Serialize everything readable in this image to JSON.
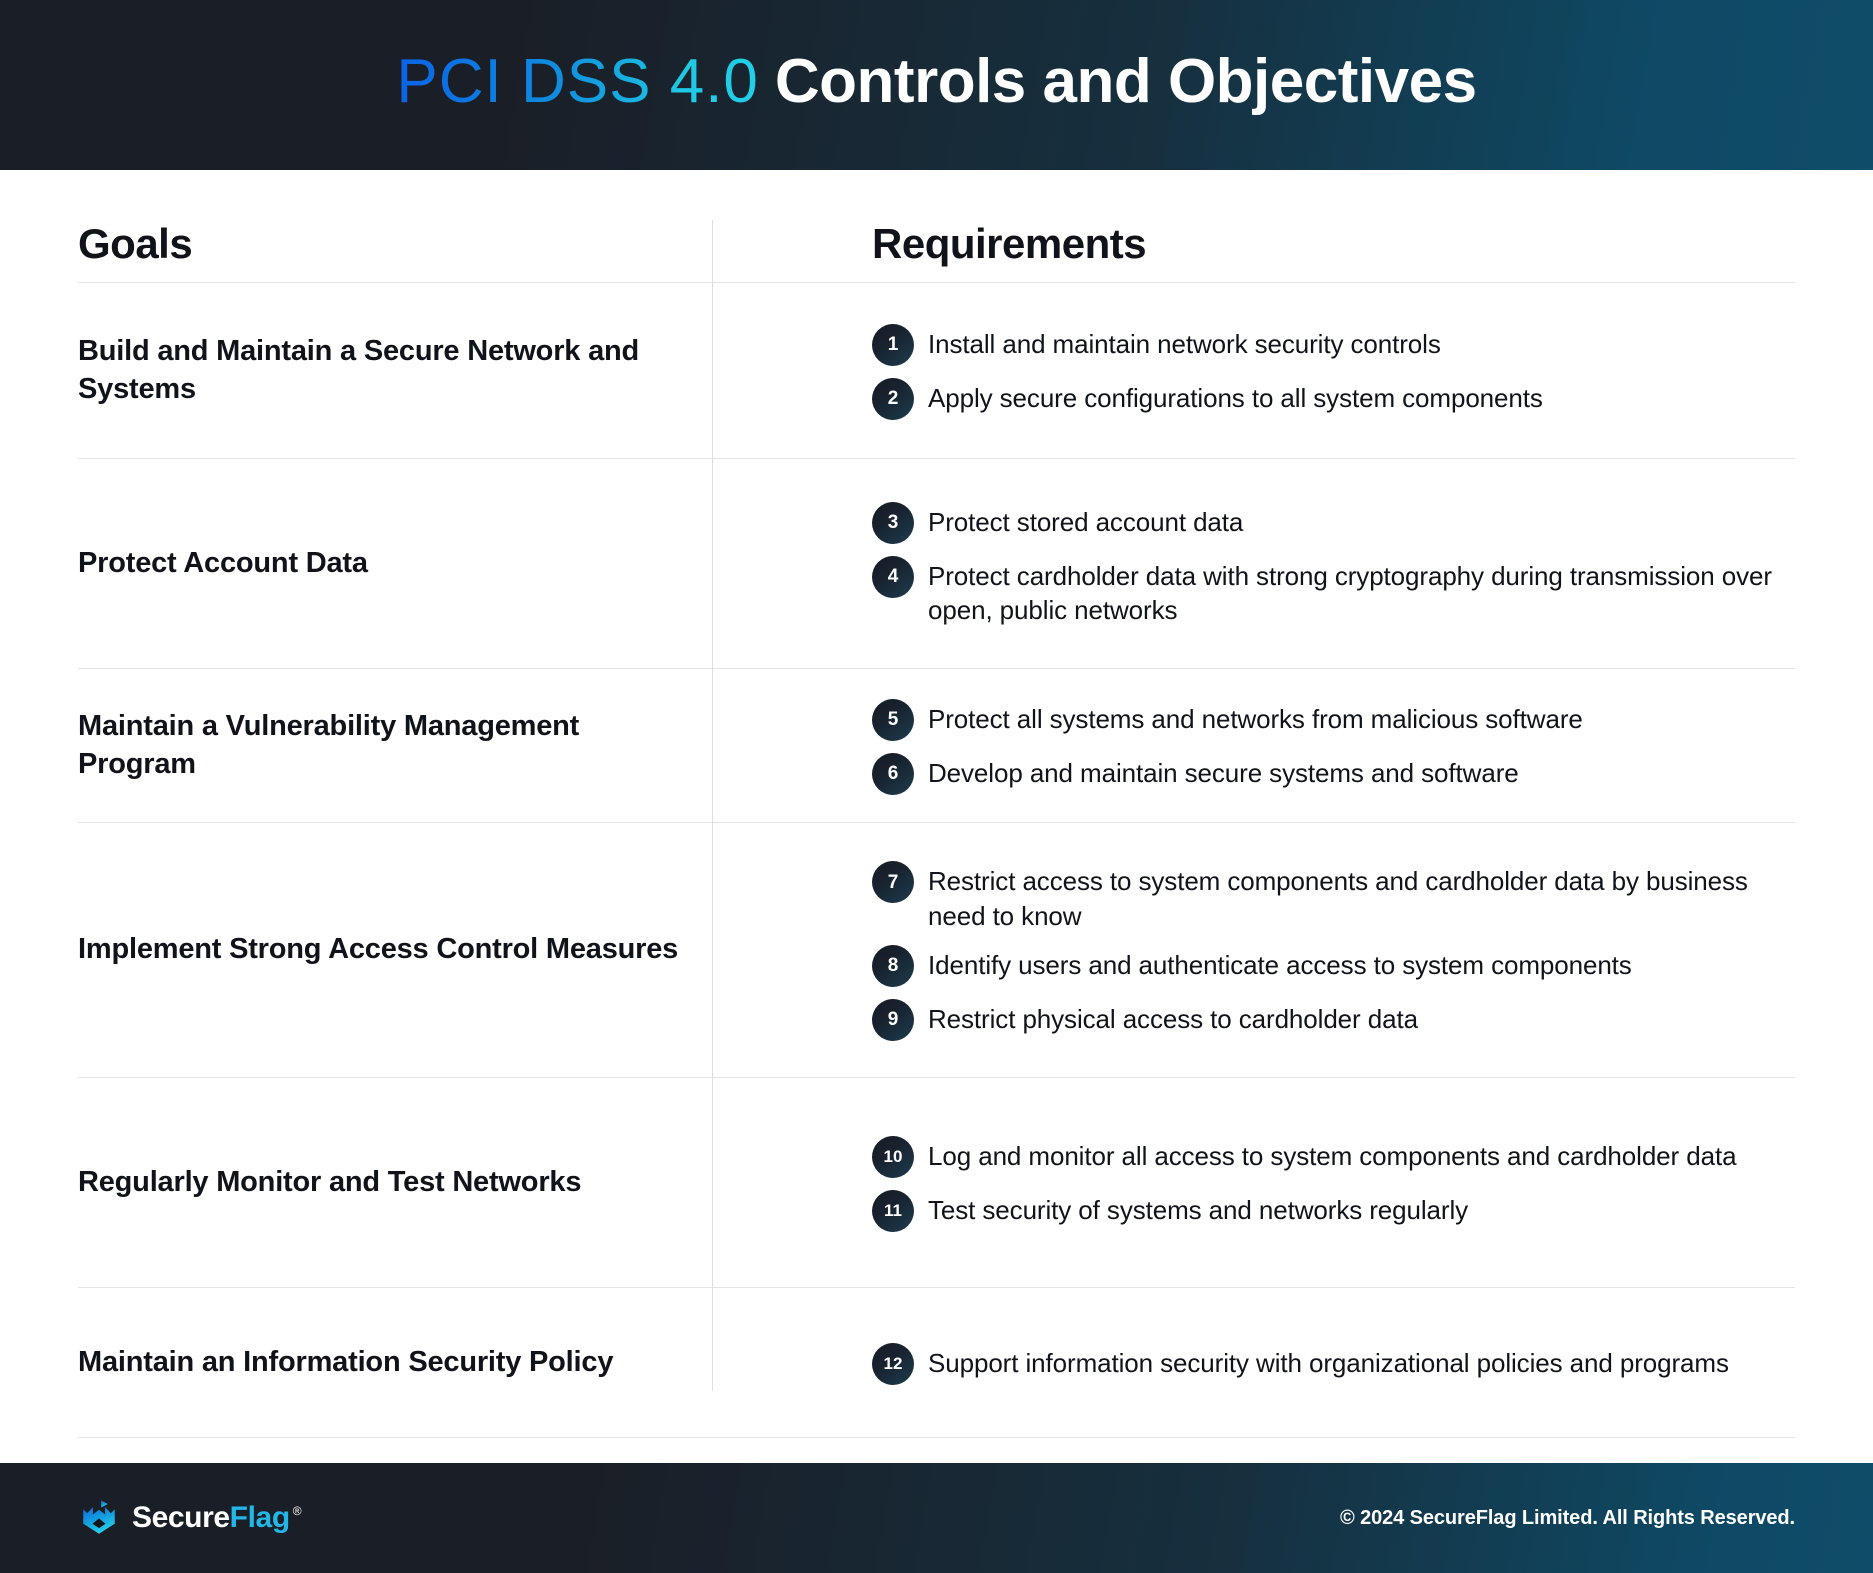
{
  "header": {
    "title_brand": "PCI  DSS 4.0",
    "title_main": "Controls and Objectives",
    "brand_gradient_start": "#0b63e5",
    "brand_gradient_end": "#22cfe8",
    "bg_gradient_start": "#1a1e26",
    "bg_gradient_end": "#0f4c69"
  },
  "table": {
    "columns": {
      "goals": "Goals",
      "requirements": "Requirements"
    },
    "rows": [
      {
        "goal": "Build and Maintain a Secure Network and Systems",
        "requirements": [
          {
            "number": "1",
            "text": "Install and maintain network security controls"
          },
          {
            "number": "2",
            "text": "Apply secure configurations to all system components"
          }
        ]
      },
      {
        "goal": "Protect Account Data",
        "requirements": [
          {
            "number": "3",
            "text": "Protect stored account data"
          },
          {
            "number": "4",
            "text": "Protect cardholder data with strong cryptography during transmission over open, public networks"
          }
        ]
      },
      {
        "goal": "Maintain a Vulnerability Management Program",
        "requirements": [
          {
            "number": "5",
            "text": "Protect all systems and networks from malicious software"
          },
          {
            "number": "6",
            "text": "Develop and maintain secure systems and software"
          }
        ]
      },
      {
        "goal": "Implement Strong Access Control Measures",
        "requirements": [
          {
            "number": "7",
            "text": "Restrict access to system components and cardholder data by business need to know"
          },
          {
            "number": "8",
            "text": "Identify users and authenticate access to system components"
          },
          {
            "number": "9",
            "text": "Restrict physical access to cardholder data"
          }
        ]
      },
      {
        "goal": "Regularly Monitor and Test Networks",
        "requirements": [
          {
            "number": "10",
            "text": "Log and monitor all access to system components and cardholder data"
          },
          {
            "number": "11",
            "text": "Test security of systems and networks regularly"
          }
        ]
      },
      {
        "goal": "Maintain an Information Security Policy",
        "requirements": [
          {
            "number": "12",
            "text": "Support information security with organizational policies and programs"
          }
        ]
      }
    ]
  },
  "footer": {
    "logo_icon": "secureflag-shield-icon",
    "brand_secure": "Secure",
    "brand_flag": "Flag",
    "brand_registered": "®",
    "copyright": "© 2024 SecureFlag Limited. All Rights Reserved.",
    "accent_color": "#22b7e8"
  }
}
